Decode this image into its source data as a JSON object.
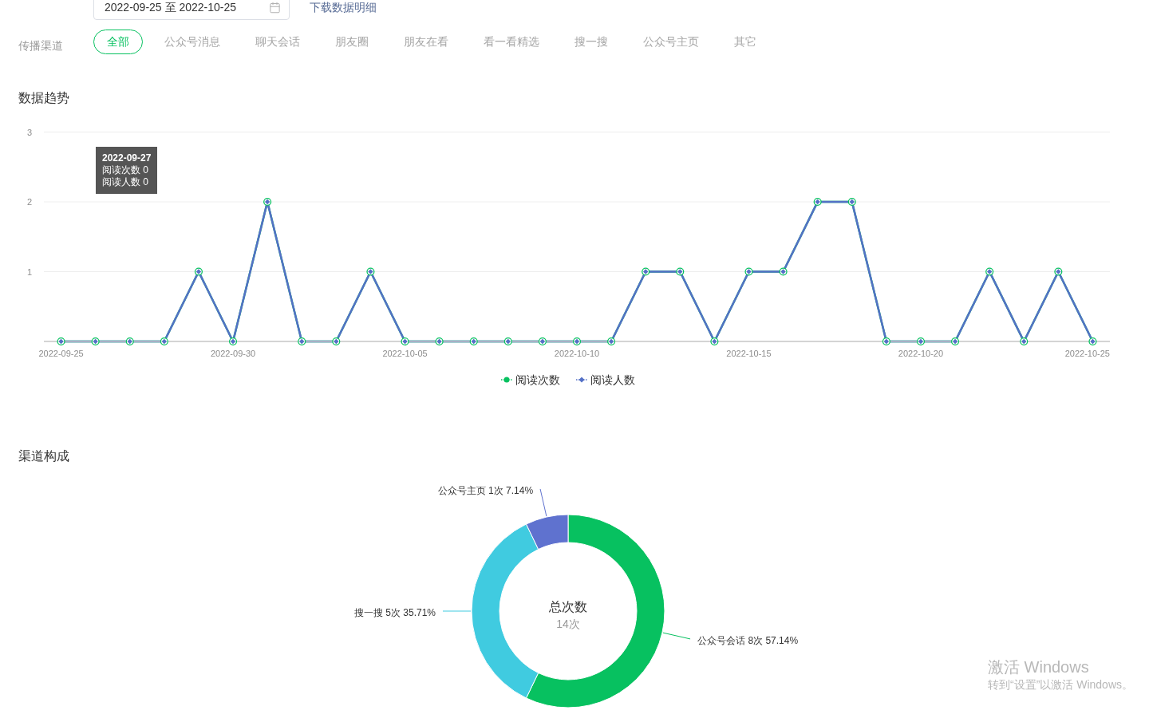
{
  "filters": {
    "date_range": {
      "value": "2022-09-25 至 2022-10-25"
    },
    "download_link": "下载数据明细",
    "channel_label": "传播渠道",
    "channel_tabs": [
      {
        "label": "全部",
        "selected": true
      },
      {
        "label": "公众号消息",
        "selected": false
      },
      {
        "label": "聊天会话",
        "selected": false
      },
      {
        "label": "朋友圈",
        "selected": false
      },
      {
        "label": "朋友在看",
        "selected": false
      },
      {
        "label": "看一看精选",
        "selected": false
      },
      {
        "label": "搜一搜",
        "selected": false
      },
      {
        "label": "公众号主页",
        "selected": false
      },
      {
        "label": "其它",
        "selected": false
      }
    ]
  },
  "trend": {
    "title": "数据趋势",
    "chart_data": {
      "type": "line",
      "categories": [
        "2022-09-25",
        null,
        null,
        null,
        null,
        "2022-09-30",
        null,
        null,
        null,
        null,
        "2022-10-05",
        null,
        null,
        null,
        null,
        "2022-10-10",
        null,
        null,
        null,
        null,
        "2022-10-15",
        null,
        null,
        null,
        null,
        "2022-10-20",
        null,
        null,
        null,
        null,
        "2022-10-25"
      ],
      "series": [
        {
          "name": "阅读次数",
          "color": "#07c160",
          "marker": "circle",
          "values": [
            0,
            0,
            0,
            0,
            1,
            0,
            2,
            0,
            0,
            1,
            0,
            0,
            0,
            0,
            0,
            0,
            0,
            1,
            1,
            0,
            1,
            1,
            2,
            2,
            0,
            0,
            0,
            1,
            0,
            1,
            0
          ]
        },
        {
          "name": "阅读人数",
          "color": "#5470c6",
          "marker": "diamond",
          "values": [
            0,
            0,
            0,
            0,
            1,
            0,
            2,
            0,
            0,
            1,
            0,
            0,
            0,
            0,
            0,
            0,
            0,
            1,
            1,
            0,
            1,
            1,
            2,
            2,
            0,
            0,
            0,
            1,
            0,
            1,
            0
          ]
        }
      ],
      "ylim": [
        0,
        3
      ],
      "yticks": [
        1,
        2,
        3
      ]
    },
    "tooltip": {
      "title": "2022-09-27",
      "lines": [
        "阅读次数 0",
        "阅读人数 0"
      ]
    }
  },
  "composition": {
    "title": "渠道构成",
    "center_title": "总次数",
    "center_value": "14次",
    "chart_data": {
      "type": "donut",
      "categories": [
        "公众号会话",
        "搜一搜",
        "公众号主页"
      ],
      "values": [
        8,
        5,
        1
      ],
      "colors": [
        "#07c160",
        "#40cbe0",
        "#5f72cf"
      ],
      "value_labels": [
        "8次 57.14%",
        "5次 35.71%",
        "1次 7.14%"
      ]
    }
  },
  "system_notice": {
    "title": "激活 Windows",
    "message": "转到“设置”以激活 Windows。"
  }
}
